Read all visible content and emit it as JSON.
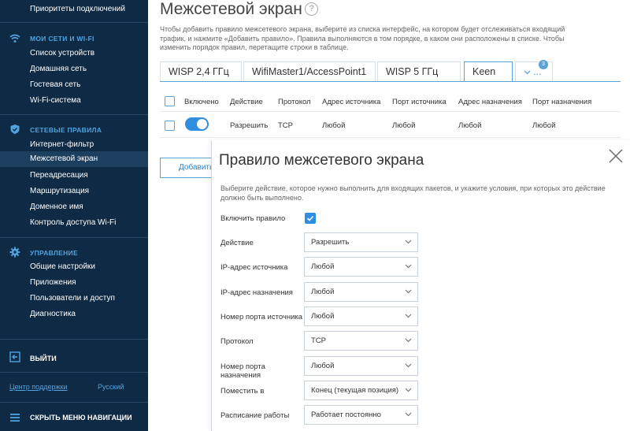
{
  "sidebar": {
    "top_item": "Приоритеты подключений",
    "sections": [
      {
        "title": "Мои сети и Wi-Fi",
        "icon": "wifi-icon",
        "items": [
          "Список устройств",
          "Домашняя сеть",
          "Гостевая сеть",
          "Wi-Fi-система"
        ]
      },
      {
        "title": "Сетевые правила",
        "icon": "shield-icon",
        "items": [
          "Интернет-фильтр",
          "Межсетевой экран",
          "Переадресация",
          "Маршрутизация",
          "Доменное имя",
          "Контроль доступа Wi-Fi"
        ]
      },
      {
        "title": "Управление",
        "icon": "gear-icon",
        "items": [
          "Общие настройки",
          "Приложения",
          "Пользователи и доступ",
          "Диагностика"
        ]
      }
    ],
    "active_item": "Межсетевой экран",
    "logout": "Выйти",
    "support_link": "Центр поддержки",
    "language": "Русский",
    "hide_nav": "Скрыть меню навигации"
  },
  "main": {
    "title": "Межсетевой экран",
    "help": "?",
    "description": "Чтобы добавить правило межсетевого экрана, выберите из списка интерфейс, на котором будет отслеживаться входящий трафик, и нажмите «Добавить правило». Правила выполняются в том порядке, в каком они расположены в списке. Чтобы изменить порядок правил, перетащите строки в таблице.",
    "tabs": [
      "WISP 2,4 ГГц",
      "WifiMaster1/AccessPoint1",
      "WISP 5 ГГц",
      "Keen"
    ],
    "active_tab": "Keen",
    "more_tab": "...",
    "more_badge": "3",
    "table": {
      "headers": [
        "Включено",
        "Действие",
        "Протокол",
        "Адрес источника",
        "Порт источника",
        "Адрес назначения",
        "Порт назначения"
      ],
      "rows": [
        {
          "enabled": true,
          "action": "Разрешить",
          "protocol": "TCP",
          "src_addr": "Любой",
          "src_port": "Любой",
          "dst_addr": "Любой",
          "dst_port": "Любой"
        }
      ]
    },
    "add_button": "Добавить"
  },
  "modal": {
    "title": "Правило межсетевого экрана",
    "description": "Выберите действие, которое нужно выполнить для входящих пакетов, и укажите условия, при которых это действие должно быть выполнено.",
    "enable_label": "Включить правило",
    "enabled": true,
    "fields": [
      {
        "label": "Действие",
        "value": "Разрешить"
      },
      {
        "label": "IP-адрес источника",
        "value": "Любой"
      },
      {
        "label": "IP-адрес назначения",
        "value": "Любой"
      },
      {
        "label": "Номер порта источника",
        "value": "Любой"
      },
      {
        "label": "Протокол",
        "value": "TCP"
      },
      {
        "label": "Номер порта назначения",
        "value": "Любой"
      },
      {
        "label": "Поместить в",
        "value": "Конец (текущая позиция)"
      },
      {
        "label": "Расписание работы",
        "value": "Работает постоянно"
      }
    ]
  },
  "colors": {
    "sidebar_bg": "#0e2a44",
    "accent": "#2f8ee0",
    "section_title": "#4fa3e0"
  }
}
